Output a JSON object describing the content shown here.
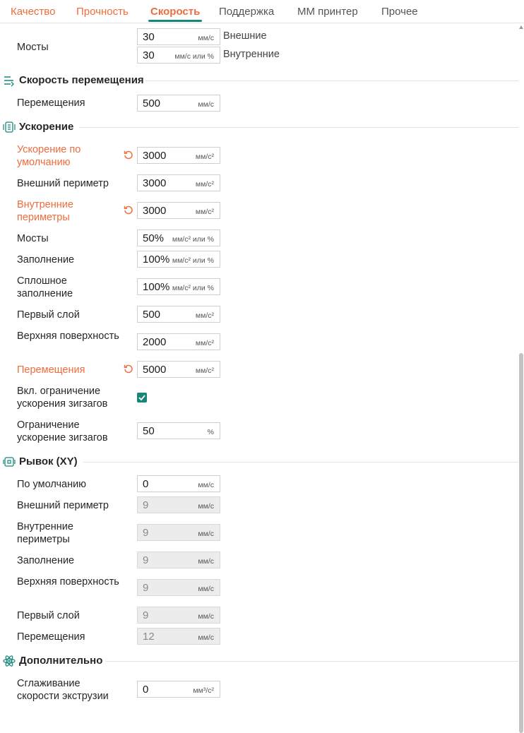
{
  "tabs": [
    "Качество",
    "Прочность",
    "Скорость",
    "Поддержка",
    "ММ принтер",
    "Прочее"
  ],
  "bridges": {
    "label": "Мосты",
    "outer_value": "30",
    "outer_unit": "мм/с",
    "outer_label": "Внешние",
    "inner_value": "30",
    "inner_unit": "мм/с или %",
    "inner_label": "Внутренние"
  },
  "travel_speed": {
    "title": "Скорость перемещения",
    "row": {
      "label": "Перемещения",
      "value": "500",
      "unit": "мм/с"
    }
  },
  "acceleration": {
    "title": "Ускорение",
    "rows": [
      {
        "label": "Ускорение по умолчанию",
        "value": "3000",
        "unit": "мм/с²",
        "modified": true
      },
      {
        "label": "Внешний периметр",
        "value": "3000",
        "unit": "мм/с²"
      },
      {
        "label": "Внутренние периметры",
        "value": "3000",
        "unit": "мм/с²",
        "modified": true
      },
      {
        "label": "Мосты",
        "value": "50%",
        "unit": "мм/с² или %"
      },
      {
        "label": "Заполнение",
        "value": "100%",
        "unit": "мм/с² или %"
      },
      {
        "label": "Сплошное заполнение",
        "value": "100%",
        "unit": "мм/с² или %"
      },
      {
        "label": "Первый слой",
        "value": "500",
        "unit": "мм/с²"
      },
      {
        "label": "Верхняя поверхность",
        "value": "2000",
        "unit": "мм/с²"
      },
      {
        "label": "Перемещения",
        "value": "5000",
        "unit": "мм/с²",
        "modified": true
      }
    ],
    "zigzag_enable_label": "Вкл. ограничение ускорения зигзагов",
    "zigzag_enable_checked": true,
    "zigzag_limit": {
      "label": "Ограничение ускорение зигзагов",
      "value": "50",
      "unit": "%"
    }
  },
  "jerk": {
    "title": "Рывок (XY)",
    "rows": [
      {
        "label": "По умолчанию",
        "value": "0",
        "unit": "мм/с"
      },
      {
        "label": "Внешний периметр",
        "value": "9",
        "unit": "мм/с",
        "disabled": true
      },
      {
        "label": "Внутренние периметры",
        "value": "9",
        "unit": "мм/с",
        "disabled": true
      },
      {
        "label": "Заполнение",
        "value": "9",
        "unit": "мм/с",
        "disabled": true
      },
      {
        "label": "Верхняя поверхность",
        "value": "9",
        "unit": "мм/с",
        "disabled": true
      },
      {
        "label": "Первый слой",
        "value": "9",
        "unit": "мм/с",
        "disabled": true
      },
      {
        "label": "Перемещения",
        "value": "12",
        "unit": "мм/с",
        "disabled": true
      }
    ]
  },
  "advanced": {
    "title": "Дополнительно",
    "row": {
      "label": "Сглаживание скорости экструзии",
      "value": "0",
      "unit": "мм³/с²"
    }
  },
  "colors": {
    "accent": "#ef6c3d",
    "teal": "#17877a"
  }
}
